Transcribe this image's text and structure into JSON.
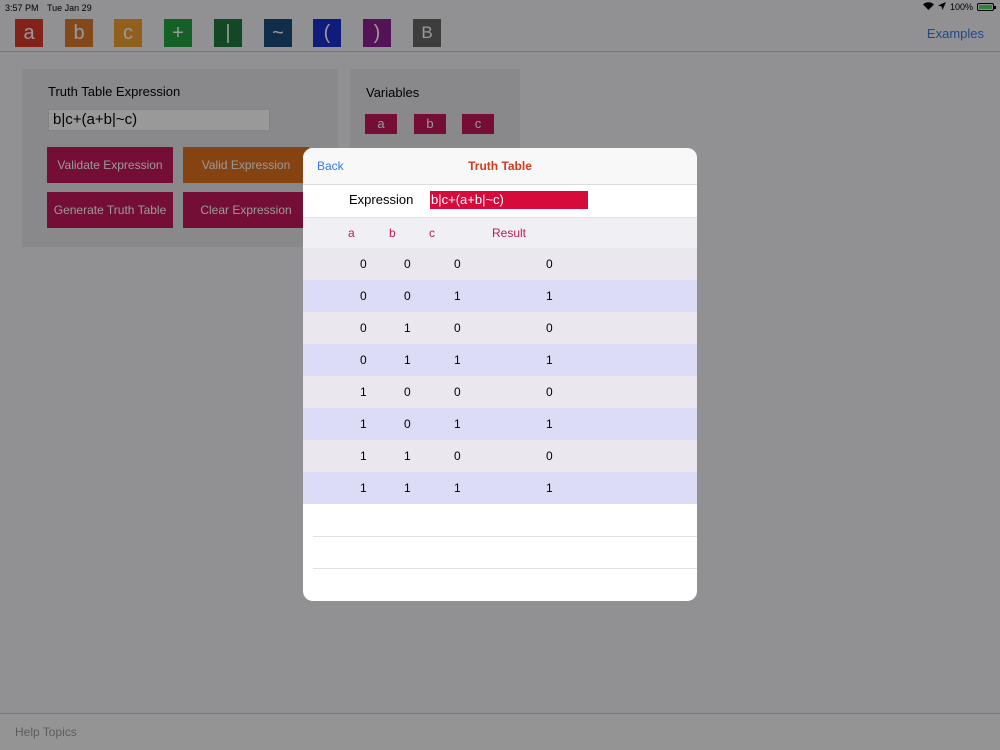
{
  "status": {
    "time": "3:57 PM",
    "date": "Tue Jan 29",
    "battery": "100%"
  },
  "toolbar": {
    "buttons": [
      {
        "label": "a",
        "color": "#d93a2a"
      },
      {
        "label": "b",
        "color": "#db7a2e"
      },
      {
        "label": "c",
        "color": "#f0a030"
      },
      {
        "label": "+",
        "color": "#22a040"
      },
      {
        "label": "|",
        "color": "#1e7a3c"
      },
      {
        "label": "~",
        "color": "#1c4b7a"
      },
      {
        "label": "(",
        "color": "#1a2fcf"
      },
      {
        "label": ")",
        "color": "#8d1f92"
      },
      {
        "label": "B",
        "color": "#666666"
      }
    ],
    "examples_label": "Examples"
  },
  "expression_panel": {
    "title": "Truth Table Expression",
    "value": "b|c+(a+b|~c)",
    "validate_label": "Validate Expression",
    "valid_label": "Valid Expression",
    "generate_label": "Generate Truth Table",
    "clear_label": "Clear Expression"
  },
  "variables_panel": {
    "title": "Variables",
    "items": [
      "a",
      "b",
      "c"
    ]
  },
  "help_label": "Help Topics",
  "modal": {
    "back_label": "Back",
    "title": "Truth Table",
    "expression_label": "Expression",
    "expression_value": "b|c+(a+b|~c)",
    "headers": [
      "a",
      "b",
      "c",
      "Result"
    ],
    "rows": [
      [
        "0",
        "0",
        "0",
        "0"
      ],
      [
        "0",
        "0",
        "1",
        "1"
      ],
      [
        "0",
        "1",
        "0",
        "0"
      ],
      [
        "0",
        "1",
        "1",
        "1"
      ],
      [
        "1",
        "0",
        "0",
        "0"
      ],
      [
        "1",
        "0",
        "1",
        "1"
      ],
      [
        "1",
        "1",
        "0",
        "0"
      ],
      [
        "1",
        "1",
        "1",
        "1"
      ]
    ]
  },
  "colors": {
    "accent_link": "#3478f6",
    "button_magenta": "#c2185b",
    "button_orange": "#e0701e",
    "title_red": "#d03a1e"
  }
}
